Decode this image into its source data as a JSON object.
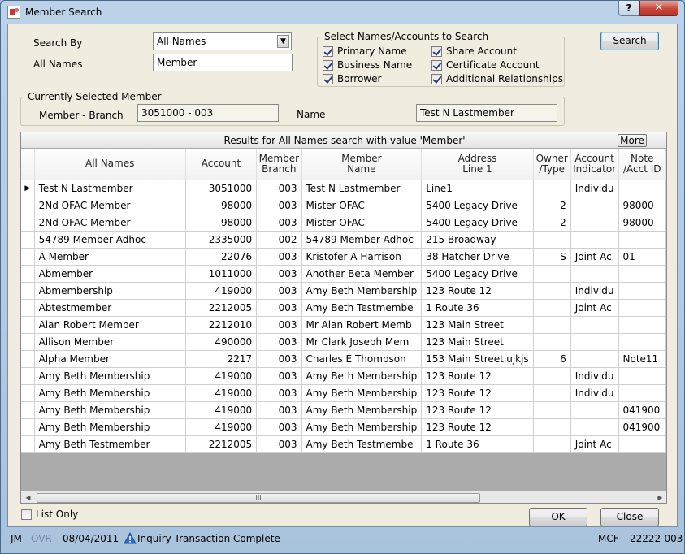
{
  "window": {
    "title": "Member Search",
    "help_label": "?",
    "close_label": "✕"
  },
  "search": {
    "search_by_label": "Search By",
    "search_by_value": "All Names",
    "all_names_label": "All Names",
    "all_names_value": "Member",
    "search_button": "Search"
  },
  "select_group": {
    "title": "Select Names/Accounts to Search",
    "options": [
      {
        "label": "Primary Name",
        "checked": true
      },
      {
        "label": "Business Name",
        "checked": true
      },
      {
        "label": "Borrower",
        "checked": true
      },
      {
        "label": "Share Account",
        "checked": true
      },
      {
        "label": "Certificate Account",
        "checked": true
      },
      {
        "label": "Additional Relationships",
        "checked": true
      }
    ]
  },
  "current_member": {
    "title": "Currently Selected Member",
    "member_branch_label": "Member - Branch",
    "member_branch_value": "3051000 - 003",
    "name_label": "Name",
    "name_value": "Test N Lastmember"
  },
  "results": {
    "caption": "Results for All Names search with value 'Member'",
    "more_button": "More",
    "columns": [
      "All Names",
      "Account",
      "Member\nBranch",
      "Member\nName",
      "Address\nLine 1",
      "Owner\n/Type",
      "Account\nIndicator",
      "Note\n/Acct ID"
    ],
    "rows": [
      [
        "Test N Lastmember",
        "3051000",
        "003",
        "Test N Lastmember",
        "Line1",
        "",
        "Individu",
        ""
      ],
      [
        "2Nd OFAC Member",
        "98000",
        "003",
        "Mister OFAC",
        "5400 Legacy Drive",
        "2",
        "",
        "98000"
      ],
      [
        "2Nd OFAC Member",
        "98000",
        "003",
        "Mister OFAC",
        "5400 Legacy Drive",
        "2",
        "",
        "98000"
      ],
      [
        "54789 Member Adhoc",
        "2335000",
        "002",
        "54789 Member Adhoc",
        "215 Broadway",
        "",
        "",
        ""
      ],
      [
        "A Member",
        "22076",
        "003",
        "Kristofer A Harrison",
        "38 Hatcher Drive",
        "S",
        "Joint Ac",
        "01"
      ],
      [
        "Abmember",
        "1011000",
        "003",
        "Another Beta Member",
        "5400 Legacy Drive",
        "",
        "",
        ""
      ],
      [
        "Abmembership",
        "419000",
        "003",
        "Amy Beth Membership",
        "123 Route 12",
        "",
        "Individu",
        ""
      ],
      [
        "Abtestmember",
        "2212005",
        "003",
        "Amy Beth Testmembe",
        "1 Route 36",
        "",
        "Joint Ac",
        ""
      ],
      [
        "Alan Robert Member",
        "2212010",
        "003",
        "Mr Alan Robert Memb",
        "123 Main Street",
        "",
        "",
        ""
      ],
      [
        "Allison Member",
        "490000",
        "003",
        "Mr Clark Joseph Mem",
        "123 Main Street",
        "",
        "",
        ""
      ],
      [
        "Alpha Member",
        "2217",
        "003",
        "Charles E Thompson",
        "153 Main Streetiujkjs",
        "6",
        "",
        "Note11"
      ],
      [
        "Amy Beth Membership",
        "419000",
        "003",
        "Amy Beth Membership",
        "123 Route 12",
        "",
        "Individu",
        ""
      ],
      [
        "Amy Beth Membership",
        "419000",
        "003",
        "Amy Beth Membership",
        "123 Route 12",
        "",
        "Individu",
        ""
      ],
      [
        "Amy Beth Membership",
        "419000",
        "003",
        "Amy Beth Membership",
        "123 Route 12",
        "",
        "",
        "041900"
      ],
      [
        "Amy Beth Membership",
        "419000",
        "003",
        "Amy Beth Membership",
        "123 Route 12",
        "",
        "",
        "041900"
      ],
      [
        "Amy Beth Testmember",
        "2212005",
        "003",
        "Amy Beth Testmembe",
        "1 Route 36",
        "",
        "Joint Ac",
        ""
      ]
    ],
    "scroll_grip": "III"
  },
  "footer": {
    "list_only_label": "List Only",
    "list_only_checked": false,
    "ok_button": "OK",
    "close_button": "Close"
  },
  "status": {
    "user": "JM",
    "ovr": "OVR",
    "date": "08/04/2011",
    "message": "Inquiry Transaction Complete",
    "mode": "MCF",
    "code": "22222-003"
  },
  "colors": {
    "accent": "#3c7fb1",
    "close": "#c8453a",
    "warning_icon": "#2f6fc6"
  }
}
